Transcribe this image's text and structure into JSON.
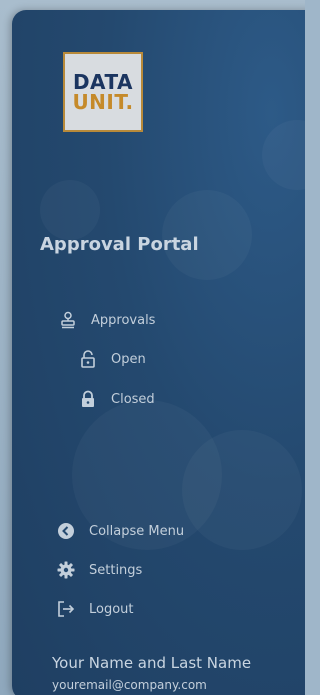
{
  "logo": {
    "line1": "DATA",
    "line2": "UNIT."
  },
  "portal": {
    "title": "Approval Portal"
  },
  "nav": {
    "approvals": {
      "label": "Approvals",
      "icon": "stamp-icon"
    },
    "open": {
      "label": "Open",
      "icon": "unlocked-icon"
    },
    "closed": {
      "label": "Closed",
      "icon": "locked-icon"
    }
  },
  "footer_nav": {
    "collapse": {
      "label": "Collapse Menu",
      "icon": "arrow-left-circle-icon"
    },
    "settings": {
      "label": "Settings",
      "icon": "gear-icon"
    },
    "logout": {
      "label": "Logout",
      "icon": "logout-icon"
    }
  },
  "user": {
    "name": "Your Name and Last Name",
    "email": "youremail@company.com"
  },
  "colors": {
    "sidebar": "#24496f",
    "text": "#c3cfdb",
    "logo_navy": "#1b3560",
    "logo_gold": "#c58a2a"
  }
}
